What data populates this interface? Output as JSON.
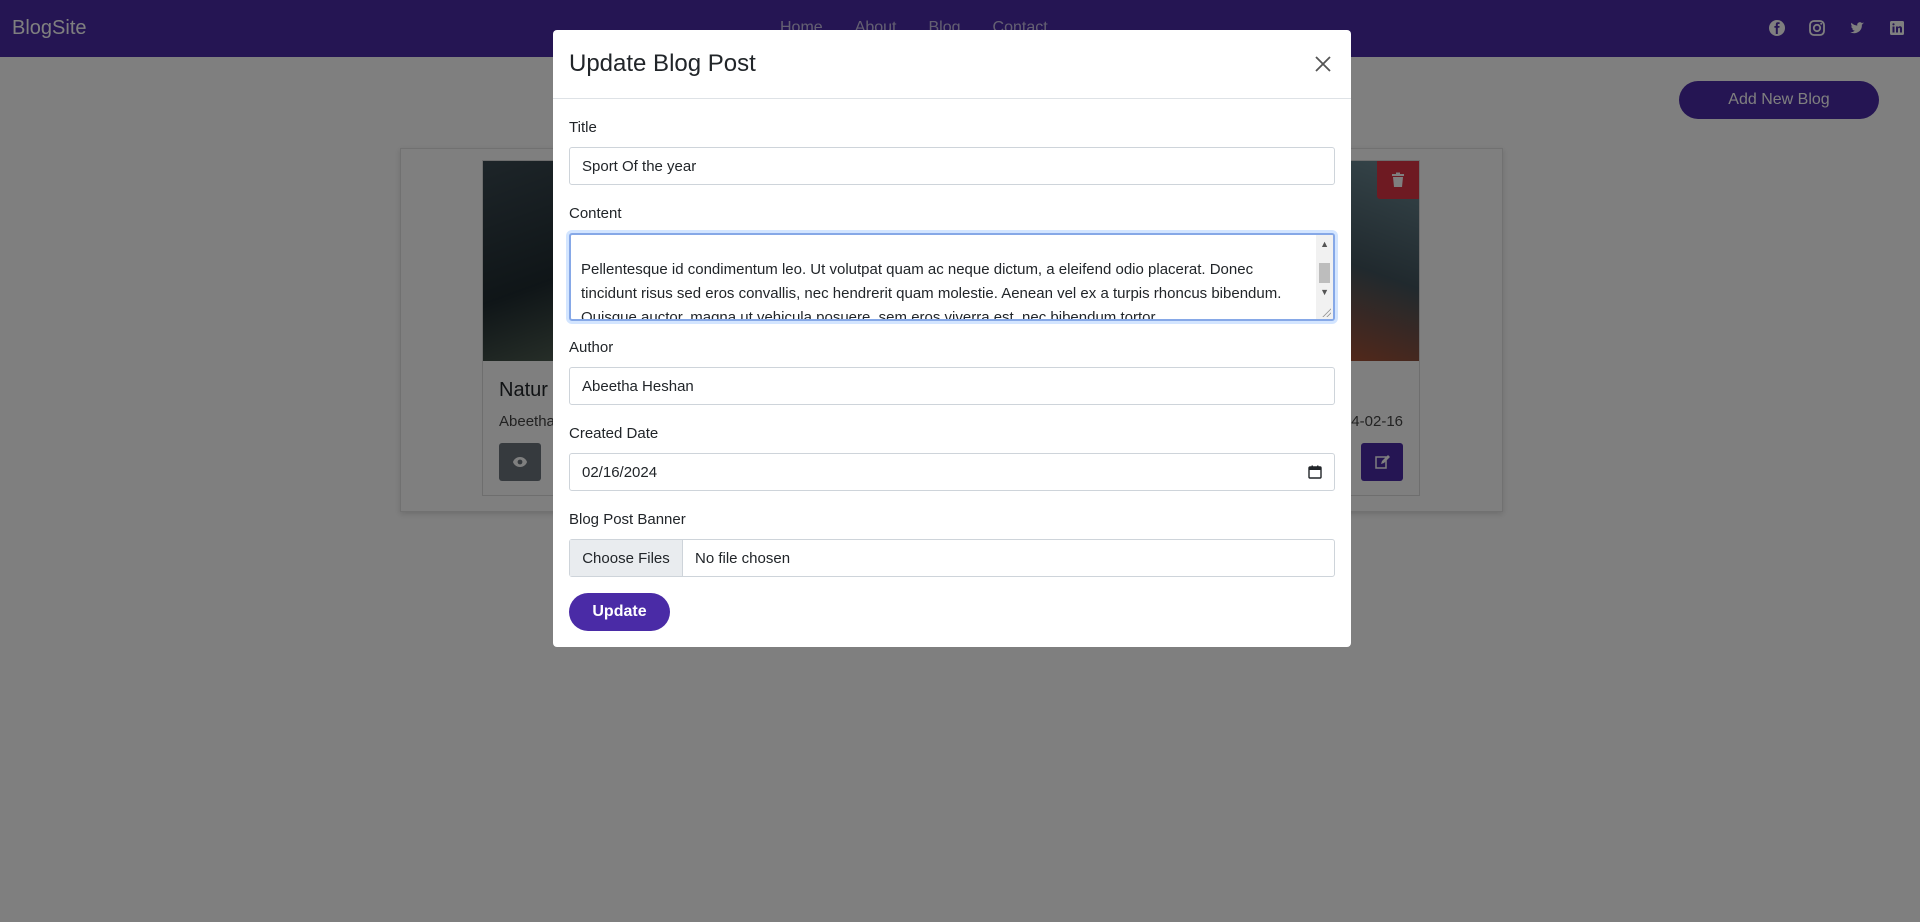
{
  "navbar": {
    "brand": "BlogSite",
    "links": [
      "Home",
      "About",
      "Blog",
      "Contact"
    ],
    "social_icons": [
      "facebook-icon",
      "instagram-icon",
      "twitter-icon",
      "linkedin-icon"
    ]
  },
  "page": {
    "add_button": "Add New Blog"
  },
  "cards": [
    {
      "title": "Natur",
      "author": "Abeetha",
      "date": ""
    },
    {
      "title": "",
      "author": "",
      "date": "4-02-16"
    }
  ],
  "modal": {
    "title": "Update Blog Post",
    "fields": {
      "title_label": "Title",
      "title_value": "Sport Of the year",
      "content_label": "Content",
      "content_value": "Pellentesque id condimentum leo. Ut volutpat quam ac neque dictum, a eleifend odio placerat. Donec tincidunt risus sed eros convallis, nec hendrerit quam molestie. Aenean vel ex a turpis rhoncus bibendum. Quisque auctor, magna ut vehicula posuere, sem eros viverra est, nec bibendum tortor",
      "author_label": "Author",
      "author_value": "Abeetha Heshan",
      "date_label": "Created Date",
      "date_value": "02/16/2024",
      "banner_label": "Blog Post Banner",
      "choose_files": "Choose Files",
      "file_status": "No file chosen"
    },
    "update_button": "Update"
  },
  "colors": {
    "brand": "#4a2ba6",
    "danger": "#dc3545",
    "secondary": "#6c757d"
  }
}
